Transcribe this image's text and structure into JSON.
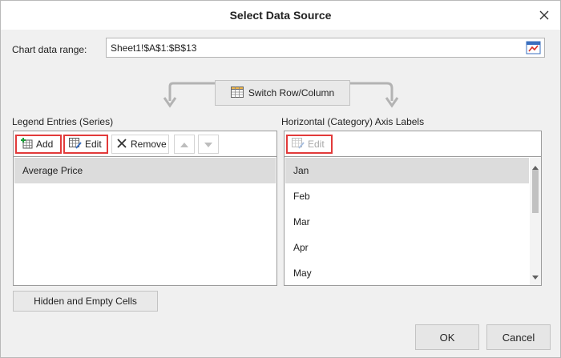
{
  "window": {
    "title": "Select Data Source"
  },
  "range": {
    "label": "Chart data range:",
    "value": "Sheet1!$A$1:$B$13"
  },
  "switch_button": {
    "label": "Switch Row/Column"
  },
  "legend": {
    "label": "Legend Entries (Series)",
    "add": "Add",
    "edit": "Edit",
    "remove": "Remove",
    "items": [
      "Average Price"
    ]
  },
  "axis": {
    "label": "Horizontal (Category) Axis Labels",
    "edit": "Edit",
    "items": [
      "Jan",
      "Feb",
      "Mar",
      "Apr",
      "May"
    ]
  },
  "hidden_button": {
    "label": "Hidden and Empty Cells"
  },
  "footer": {
    "ok": "OK",
    "cancel": "Cancel"
  },
  "colors": {
    "highlight": "#e23a3a",
    "selection": "#dcdcdc",
    "dialog_bg": "#f0f0f0"
  }
}
